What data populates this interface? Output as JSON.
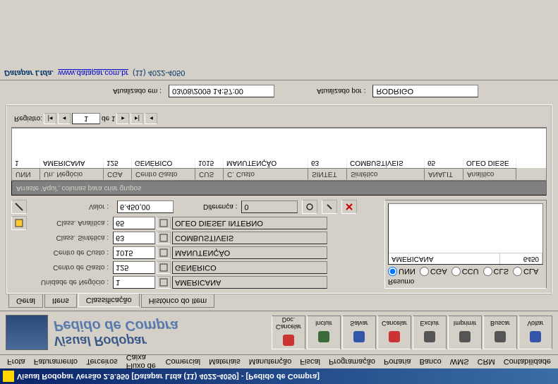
{
  "window": {
    "title": "Visual Rodopar Versão 2.9.950 [Datapar Ltda (11) 4022-4050]  - [Pedido de Compra]"
  },
  "menubar": [
    "Frota",
    "Faturamento",
    "Terceiros",
    "Fluxo de Caixa",
    "Comercial",
    "Materiais",
    "Manutenção",
    "Fiscal",
    "Programação",
    "Portaria",
    "Banco",
    "WMS",
    "CRM",
    "Contabilidade"
  ],
  "header": {
    "brand": "Visual Rodopar",
    "module": "Pedido de Compra"
  },
  "toolbar": [
    {
      "label": "Cancelar Doc.",
      "icon": "stop-icon",
      "color": "#cc3333"
    },
    {
      "label": "Incluir",
      "icon": "plus-icon",
      "color": "#3a6a3a"
    },
    {
      "label": "Salvar",
      "icon": "disk-icon",
      "color": "#3355aa"
    },
    {
      "label": "Cancelar",
      "icon": "cancel-icon",
      "color": "#cc3333"
    },
    {
      "label": "Excluir",
      "icon": "trash-icon",
      "color": "#555"
    },
    {
      "label": "Imprimir",
      "icon": "printer-icon",
      "color": "#555"
    },
    {
      "label": "Buscar",
      "icon": "search-icon",
      "color": "#555"
    },
    {
      "label": "Voltar",
      "icon": "back-icon",
      "color": "#3355aa"
    }
  ],
  "tabs": [
    "Geral",
    "Itens",
    "Classificação",
    "Histórico do Item"
  ],
  "active_tab": 2,
  "side_icons": true,
  "form": {
    "unidade_negocio": {
      "label": "Unidade de Negócio :",
      "code": "1",
      "desc": "AMERICANA"
    },
    "centro_gasto": {
      "label": "Centro de Gasto :",
      "code": "125",
      "desc": "GENÉRICO"
    },
    "centro_custo": {
      "label": "Centro de Custo :",
      "code": "1015",
      "desc": "MANUTENÇÃO"
    },
    "class_sintetica": {
      "label": "Class. Sintética :",
      "code": "63",
      "desc": "COMBUSTÍVEIS"
    },
    "class_analitica": {
      "label": "Class. Analítica :",
      "code": "65",
      "desc": "OLEO DIESEL INTERNO"
    },
    "valor_label": "Valor :",
    "valor": "6.450,00",
    "diferenca_label": "Diferença :",
    "diferenca": "0"
  },
  "resumo": {
    "title": "Resumo",
    "radios": [
      "UNN",
      "CGA",
      "CCU",
      "CLS",
      "CLA"
    ],
    "selected": "UNN",
    "rows": [
      {
        "c1": "AMERICANA",
        "c2": "6450"
      }
    ]
  },
  "group_hint": "Arraste 'Aqui', colunas para criar grupos",
  "grid": {
    "columns": [
      "UNN",
      "Un. Negócio",
      "CGA",
      "Centro Gasto",
      "CUS",
      "C. Custo",
      "SINTET",
      "Sintético",
      "ANALIT",
      "Analítico"
    ],
    "rows": [
      [
        "1",
        "AMERICANA",
        "125",
        "GENÉRICO",
        "1015",
        "MANUTENÇÃO",
        "63",
        "COMBUSTÍVEIS",
        "65",
        "OLEO DIESE"
      ]
    ]
  },
  "recordnav": {
    "label": "Registro:",
    "current": "1",
    "of": "de 1"
  },
  "footer": {
    "updated_at_label": "Atualizado em :",
    "updated_at": "03/08/2009 14:57:00",
    "updated_by_label": "Atualizado por :",
    "updated_by": "RODRIGO"
  },
  "statusbar": {
    "company": "Datapar Ltda.",
    "url": "www.datapar.com.br",
    "phone": "(11) 4022-4050"
  }
}
